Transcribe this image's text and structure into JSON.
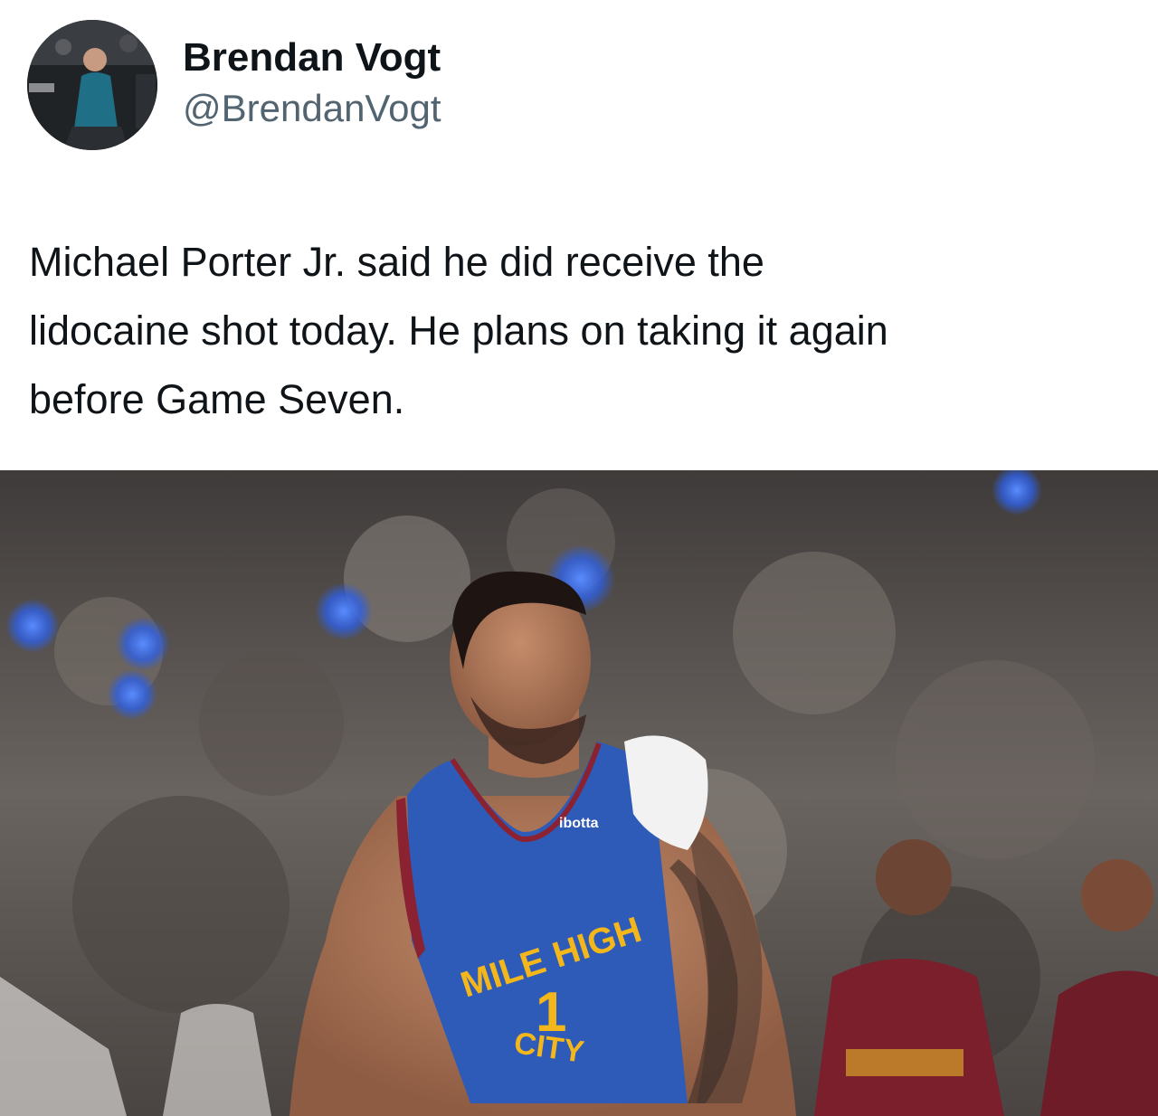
{
  "author": {
    "display_name": "Brendan Vogt",
    "handle": "@BrendanVogt",
    "avatar_icon": "profile-photo"
  },
  "tweet": {
    "lines": [
      "Michael Porter Jr. said he did receive the",
      "lidocaine shot today. He plans on taking it again",
      "before Game Seven."
    ]
  },
  "media": {
    "jersey": {
      "sponsor": "ibotta",
      "arc_top": "MILE HIGH",
      "number": "1",
      "arc_bottom": "CITY"
    },
    "colors": {
      "jersey_blue": "#2f5bb8",
      "jersey_gold": "#f3b71c",
      "jersey_trim": "#8b2232",
      "crowd_blur": "#55504e"
    }
  }
}
